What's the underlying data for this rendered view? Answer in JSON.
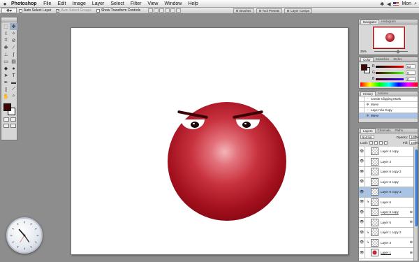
{
  "menubar": {
    "app": "Photoshop",
    "items": [
      "File",
      "Edit",
      "Image",
      "Layer",
      "Select",
      "Filter",
      "View",
      "Window",
      "Help"
    ],
    "time": "Mon"
  },
  "options": {
    "auto_select_layer": "Auto Select Layer",
    "auto_select_groups": "Auto Select Groups",
    "show_transform_controls": "Show Transform Controls",
    "well_tabs": [
      "Brushes",
      "Tool Presets",
      "Layer Comps"
    ]
  },
  "navigator": {
    "tabs": [
      "Navigator",
      "Histogram"
    ],
    "zoom": "25%"
  },
  "color_panel": {
    "tabs": [
      "Color",
      "Swatches",
      "Styles"
    ],
    "channels": [
      {
        "label": "R",
        "value": "63"
      },
      {
        "label": "G",
        "value": "0"
      },
      {
        "label": "B",
        "value": "0"
      }
    ],
    "fg_color": "#3e0505"
  },
  "history": {
    "tabs": [
      "History",
      "Actions"
    ],
    "items": [
      {
        "label": "Create Clipping Mask",
        "selected": false
      },
      {
        "label": "Move",
        "selected": false
      },
      {
        "label": "Layer Via Copy",
        "selected": false
      },
      {
        "label": "Move",
        "selected": true
      }
    ]
  },
  "layers": {
    "tabs": [
      "Layers",
      "Channels",
      "Paths"
    ],
    "blend_mode": "Normal",
    "opacity_label": "Opacity:",
    "opacity": "100%",
    "lock_label": "Lock:",
    "fill_label": "Fill:",
    "fill": "100%",
    "items": [
      {
        "name": "Layer 4 copy",
        "selected": false,
        "indented": false,
        "fx": false,
        "underlined": false
      },
      {
        "name": "Layer 4",
        "selected": false,
        "indented": false,
        "fx": false,
        "underlined": false
      },
      {
        "name": "Layer 6 copy 2",
        "selected": false,
        "indented": false,
        "fx": false,
        "underlined": false
      },
      {
        "name": "Layer 6 copy",
        "selected": false,
        "indented": false,
        "fx": false,
        "underlined": false
      },
      {
        "name": "Layer 6 copy 3",
        "selected": true,
        "indented": false,
        "fx": false,
        "underlined": false
      },
      {
        "name": "Layer 6",
        "selected": false,
        "indented": true,
        "fx": false,
        "underlined": false
      },
      {
        "name": "Layer 5 copy",
        "selected": false,
        "indented": false,
        "fx": true,
        "underlined": true
      },
      {
        "name": "Layer 5",
        "selected": false,
        "indented": false,
        "fx": true,
        "underlined": false
      },
      {
        "name": "Layer 1 copy 2",
        "selected": false,
        "indented": true,
        "fx": false,
        "underlined": false
      },
      {
        "name": "Layer 3",
        "selected": false,
        "indented": true,
        "fx": true,
        "underlined": false
      },
      {
        "name": "Layer 1",
        "selected": false,
        "indented": false,
        "fx": true,
        "underlined": true
      }
    ]
  },
  "icons": {
    "apple": "apple-icon",
    "move_tool": "move-tool-icon",
    "eye": "eye-icon"
  }
}
